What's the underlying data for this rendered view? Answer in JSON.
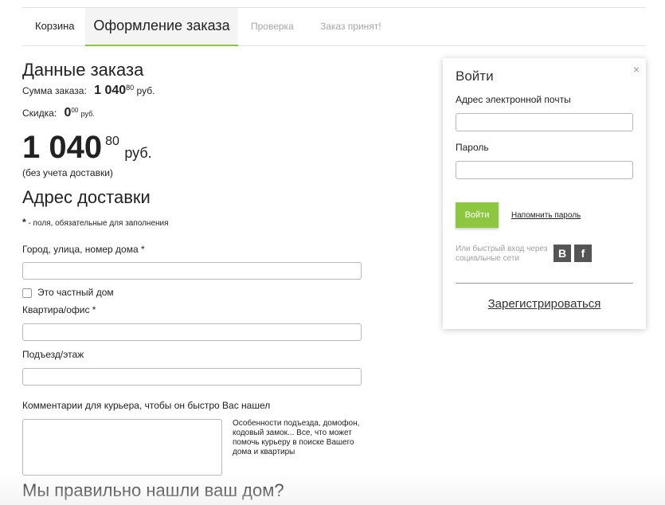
{
  "tabs": {
    "cart": "Корзина",
    "checkout": "Оформление заказа",
    "review": "Проверка",
    "accepted": "Заказ принят!"
  },
  "order": {
    "heading": "Данные заказа",
    "sum_label": "Сумма заказа:",
    "sum_value": "1 040",
    "sum_kopecks": "80",
    "sum_currency": "руб.",
    "discount_label": "Скидка:",
    "discount_value": "0",
    "discount_kopecks": "00",
    "discount_currency": "руб.",
    "total_value": "1 040",
    "total_kopecks": "80",
    "total_currency": "руб.",
    "delivery_note": "(без учета доставки)"
  },
  "address": {
    "heading": "Адрес доставки",
    "required_star": "*",
    "required_note": " - поля, обязательные для заполнения",
    "street_label": "Город, улица, номер дома *",
    "private_house_label": "Это частный дом",
    "apartment_label": "Квартира/офис *",
    "entrance_label": "Подъезд/этаж",
    "comment_label": "Комментарии для курьера, чтобы он быстро Вас нашел",
    "comment_hint": "Особенности подъезда, домофон, кодовый замок... Все, что может помочь курьеру в поиске Вашего дома и квартиры",
    "found_heading": "Мы правильно нашли ваш дом?"
  },
  "login": {
    "close": "×",
    "title": "Войти",
    "email_label": "Адрес электронной почты",
    "password_label": "Пароль",
    "submit": "Войти",
    "remind": "Напомнить пароль",
    "social_text": "Или быстрый вход через социальные сети",
    "vk": "В",
    "fb": "f",
    "register": "Зарегистрироваться"
  },
  "colors": {
    "accent": "#8dc63f"
  }
}
